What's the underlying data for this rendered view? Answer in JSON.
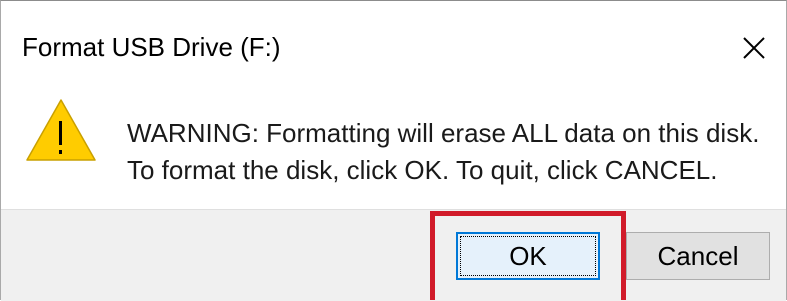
{
  "dialog": {
    "title": "Format USB Drive (F:)",
    "close_icon": "close-icon"
  },
  "content": {
    "icon": "warning-icon",
    "message_line1": "WARNING: Formatting will erase ALL data on this disk.",
    "message_line2": "To format the disk, click OK. To quit, click CANCEL."
  },
  "buttons": {
    "ok_label": "OK",
    "cancel_label": "Cancel"
  },
  "colors": {
    "highlight": "#d11b2a",
    "warning_fill": "#ffcc00",
    "focus_border": "#0078d7"
  }
}
